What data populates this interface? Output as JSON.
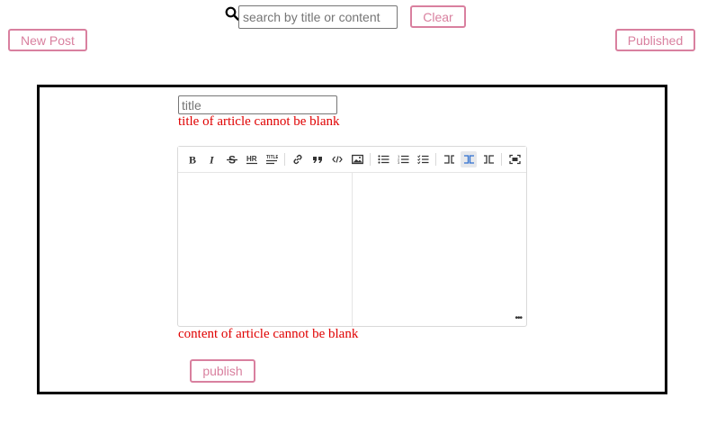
{
  "search": {
    "placeholder": "search by title or content",
    "clear_label": "Clear"
  },
  "nav": {
    "new_post_label": "New Post",
    "published_label": "Published"
  },
  "editor": {
    "title_placeholder": "title",
    "title_error": "title of article cannot be blank",
    "content_error": "content of article cannot be blank",
    "publish_label": "publish",
    "toolbar": [
      {
        "name": "bold",
        "icon": "B"
      },
      {
        "name": "italic",
        "icon": "I"
      },
      {
        "name": "strikethrough",
        "icon": "S"
      },
      {
        "name": "hr",
        "icon": "HR"
      },
      {
        "name": "title",
        "icon": "TITLE"
      },
      {
        "name": "link",
        "icon": "link"
      },
      {
        "name": "quote",
        "icon": "quote"
      },
      {
        "name": "code",
        "icon": "code"
      },
      {
        "name": "image",
        "icon": "image"
      },
      {
        "name": "unordered-list",
        "icon": "ul"
      },
      {
        "name": "ordered-list",
        "icon": "ol"
      },
      {
        "name": "task-list",
        "icon": "task"
      },
      {
        "name": "only-editor",
        "icon": "editor"
      },
      {
        "name": "split-view",
        "icon": "split"
      },
      {
        "name": "only-preview",
        "icon": "preview"
      },
      {
        "name": "fullscreen",
        "icon": "fullscreen"
      }
    ],
    "active_mode": "split-view"
  },
  "colors": {
    "accent": "#d9809f",
    "error": "#e00000",
    "frame": "#000000"
  }
}
